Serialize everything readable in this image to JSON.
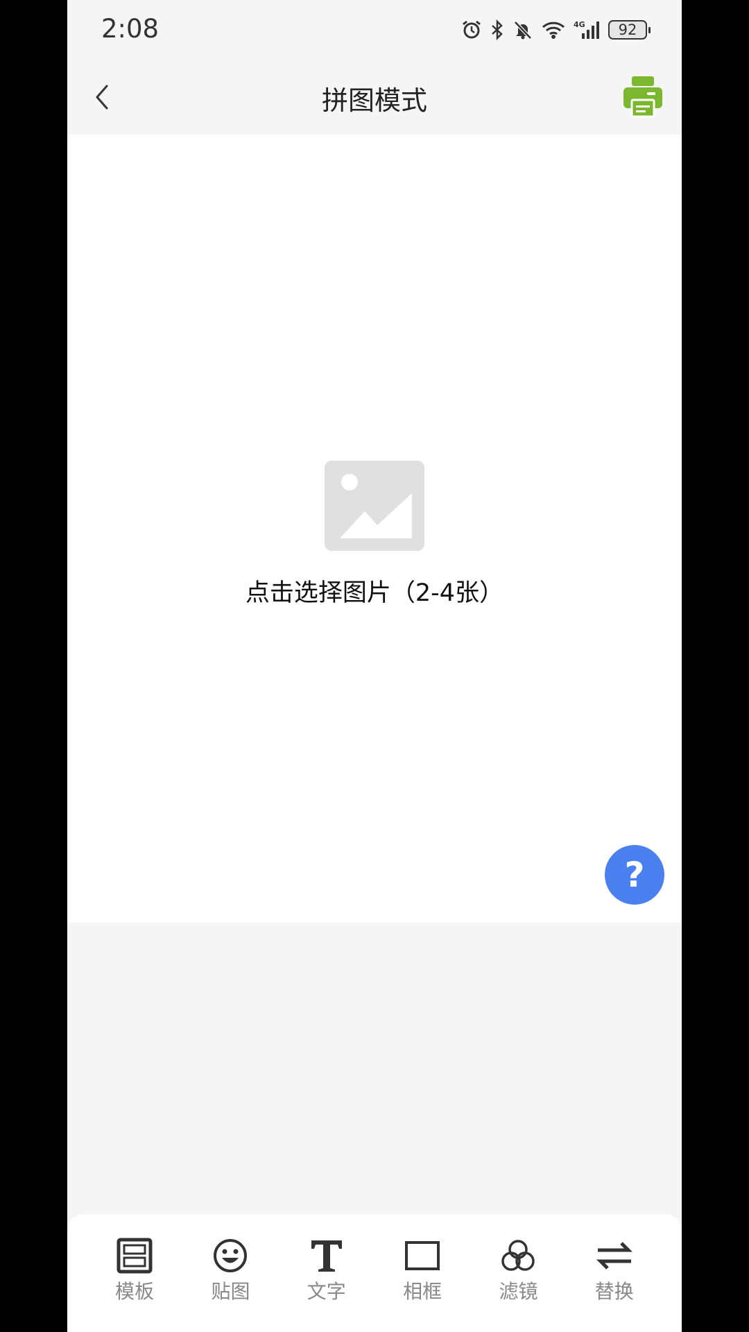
{
  "status_bar": {
    "time": "2:08",
    "battery": "92"
  },
  "header": {
    "title": "拼图模式",
    "back_icon": "chevron-left-icon",
    "print_icon": "printer-icon",
    "print_color": "#7cb82f"
  },
  "canvas": {
    "prompt": "点击选择图片（2-4张）",
    "placeholder_icon": "image-placeholder-icon",
    "help_label": "?",
    "help_color": "#4a80f0"
  },
  "toolbar": {
    "items": [
      {
        "label": "模板",
        "icon": "template-icon"
      },
      {
        "label": "贴图",
        "icon": "sticker-icon"
      },
      {
        "label": "文字",
        "icon": "text-icon"
      },
      {
        "label": "相框",
        "icon": "frame-icon"
      },
      {
        "label": "滤镜",
        "icon": "filter-icon"
      },
      {
        "label": "替换",
        "icon": "swap-icon"
      }
    ]
  }
}
